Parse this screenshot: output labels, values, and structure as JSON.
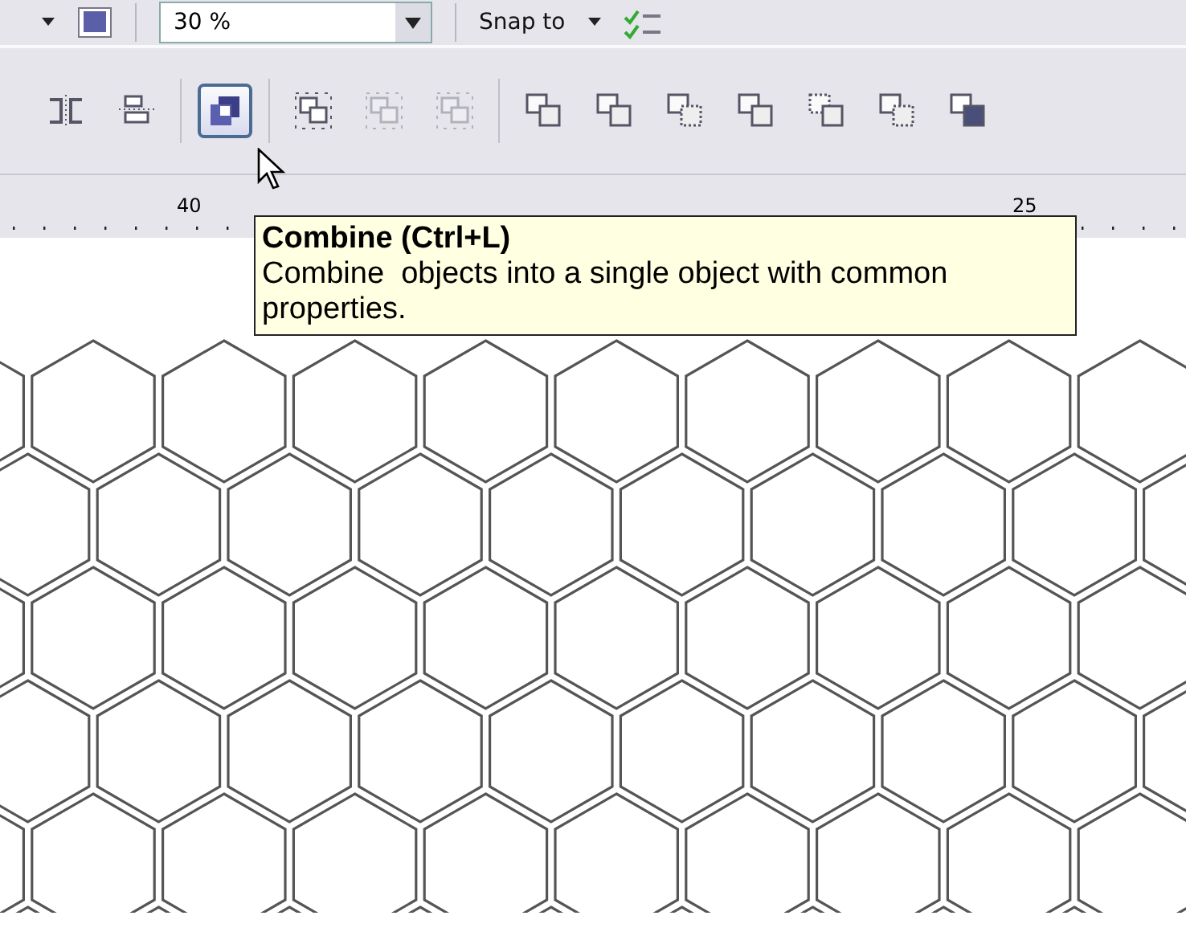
{
  "top_toolbar": {
    "zoom_value": "30 %",
    "snap_label": "Snap to"
  },
  "toolbar_buttons": [
    {
      "kind": "align-left",
      "selected": false,
      "disabled": false
    },
    {
      "kind": "align-center",
      "selected": false,
      "disabled": false
    },
    {
      "kind": "combine",
      "selected": true,
      "disabled": false
    },
    {
      "kind": "group",
      "selected": false,
      "disabled": false
    },
    {
      "kind": "ungroup",
      "selected": false,
      "disabled": true
    },
    {
      "kind": "ungroup-all",
      "selected": false,
      "disabled": true
    },
    {
      "kind": "weld",
      "selected": false,
      "disabled": false
    },
    {
      "kind": "trim",
      "selected": false,
      "disabled": false
    },
    {
      "kind": "intersect",
      "selected": false,
      "disabled": false
    },
    {
      "kind": "simplify",
      "selected": false,
      "disabled": false
    },
    {
      "kind": "front-minus-back",
      "selected": false,
      "disabled": false
    },
    {
      "kind": "back-minus-front",
      "selected": false,
      "disabled": false
    },
    {
      "kind": "boundary",
      "selected": false,
      "disabled": false
    }
  ],
  "ruler": {
    "labels": [
      "40",
      "25"
    ]
  },
  "tooltip": {
    "title": "Combine (Ctrl+L)",
    "body": "Combine  objects into a single object with common properties."
  }
}
